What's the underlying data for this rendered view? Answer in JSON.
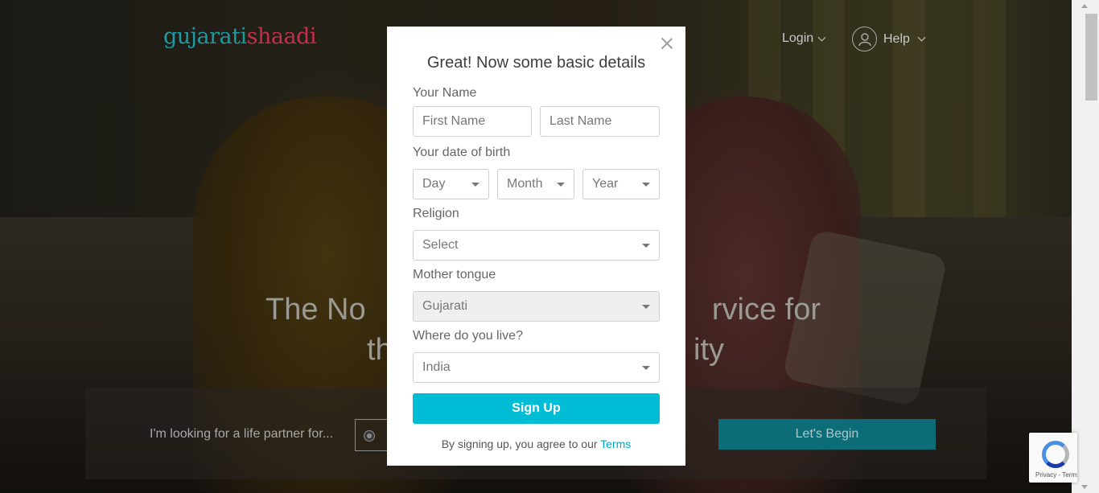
{
  "header": {
    "logo_part1": "gujarati",
    "logo_part2": "shaadi",
    "login_label": "Login",
    "help_label": "Help"
  },
  "hero": {
    "line1_left": "The No",
    "line1_right": "rvice for",
    "line2_left": "th",
    "line2_right": "ity"
  },
  "search": {
    "label": "I'm looking for a life partner for...",
    "cta_label": "Let's Begin"
  },
  "modal": {
    "title": "Great! Now some basic details",
    "name_label": "Your Name",
    "first_name_placeholder": "First Name",
    "last_name_placeholder": "Last Name",
    "dob_label": "Your date of birth",
    "day_value": "Day",
    "month_value": "Month",
    "year_value": "Year",
    "religion_label": "Religion",
    "religion_value": "Select",
    "mother_tongue_label": "Mother tongue",
    "mother_tongue_value": "Gujarati",
    "location_label": "Where do you live?",
    "location_value": "India",
    "signup_label": "Sign Up",
    "terms_prefix": "By signing up, you agree to our ",
    "terms_link": "Terms"
  },
  "recaptcha": {
    "text": "Privacy - Terms"
  },
  "colors": {
    "accent": "#00bcd5",
    "brand_teal": "#1e9aa3",
    "brand_red": "#c4304a"
  }
}
